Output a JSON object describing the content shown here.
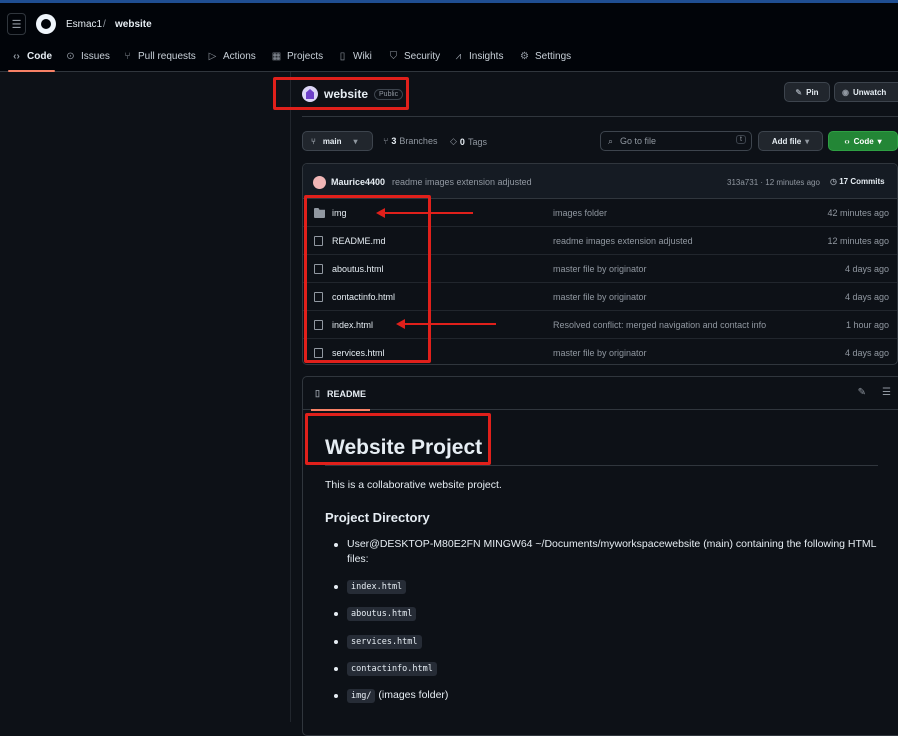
{
  "header": {
    "owner": "Esmac1",
    "separator": "/",
    "repo": "website",
    "tabs": [
      {
        "label": "Code",
        "icon": "code-icon"
      },
      {
        "label": "Issues",
        "icon": "issue-icon"
      },
      {
        "label": "Pull requests",
        "icon": "pull-request-icon"
      },
      {
        "label": "Actions",
        "icon": "play-icon"
      },
      {
        "label": "Projects",
        "icon": "table-icon"
      },
      {
        "label": "Wiki",
        "icon": "book-icon"
      },
      {
        "label": "Security",
        "icon": "shield-icon"
      },
      {
        "label": "Insights",
        "icon": "graph-icon"
      },
      {
        "label": "Settings",
        "icon": "gear-icon"
      }
    ]
  },
  "repo": {
    "name": "website",
    "visibility": "Public",
    "pin_label": "Pin",
    "unwatch_label": "Unwatch"
  },
  "toolbar": {
    "branch": "main",
    "branches_count": "3",
    "branches_label": "Branches",
    "tags_count": "0",
    "tags_label": "Tags",
    "search_placeholder": "Go to file",
    "search_shortcut": "t",
    "add_file_label": "Add file",
    "code_label": "Code"
  },
  "commit": {
    "author": "Maurice4400",
    "message": "readme images extension adjusted",
    "meta": "313a731 · 12 minutes ago",
    "count_label": "17 Commits"
  },
  "files": [
    {
      "name": "img",
      "type": "folder",
      "message": "images folder",
      "time": "42 minutes ago"
    },
    {
      "name": "README.md",
      "type": "file",
      "message": "readme images extension adjusted",
      "time": "12 minutes ago"
    },
    {
      "name": "aboutus.html",
      "type": "file",
      "message": "master file by originator",
      "time": "4 days ago"
    },
    {
      "name": "contactinfo.html",
      "type": "file",
      "message": "master file by originator",
      "time": "4 days ago"
    },
    {
      "name": "index.html",
      "type": "file",
      "message": "Resolved conflict: merged navigation and contact info",
      "time": "1 hour ago"
    },
    {
      "name": "services.html",
      "type": "file",
      "message": "master file by originator",
      "time": "4 days ago"
    }
  ],
  "readme": {
    "tab_label": "README",
    "title": "Website Project",
    "intro": "This is a collaborative website project.",
    "section_title": "Project Directory",
    "path_line": "User@DESKTOP-M80E2FN MINGW64 ~/Documents/myworkspacewebsite (main) containing the following HTML files:",
    "items": [
      "index.html",
      "aboutus.html",
      "services.html",
      "contactinfo.html",
      "img/"
    ],
    "img_suffix": "(images folder)"
  },
  "colors": {
    "annotation_red": "#e0201b",
    "tab_underline": "#f78166",
    "green_button": "#238636"
  }
}
